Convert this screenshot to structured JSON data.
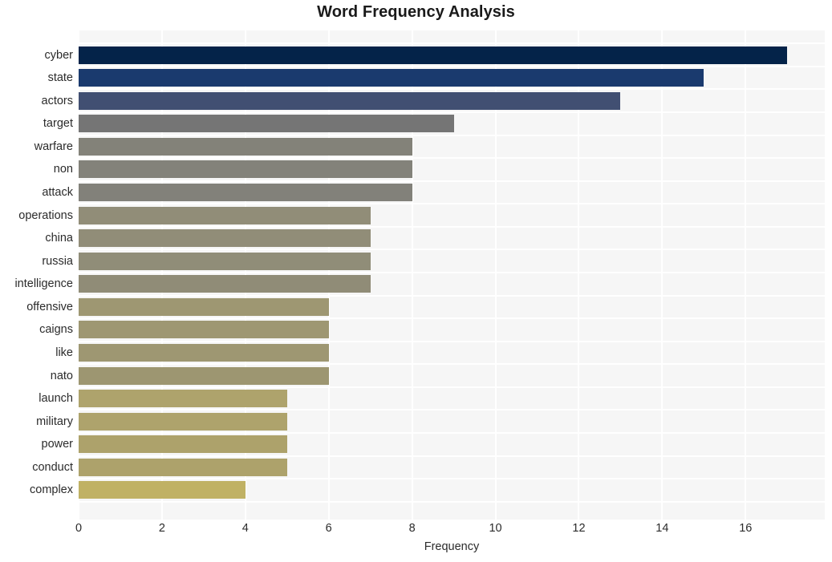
{
  "chart_data": {
    "type": "bar",
    "orientation": "horizontal",
    "title": "Word Frequency Analysis",
    "xlabel": "Frequency",
    "ylabel": "",
    "categories": [
      "cyber",
      "state",
      "actors",
      "target",
      "warfare",
      "non",
      "attack",
      "operations",
      "china",
      "russia",
      "intelligence",
      "offensive",
      "caigns",
      "like",
      "nato",
      "launch",
      "military",
      "power",
      "conduct",
      "complex"
    ],
    "values": [
      17,
      15,
      13,
      9,
      8,
      8,
      8,
      7,
      7,
      7,
      7,
      6,
      6,
      6,
      6,
      5,
      5,
      5,
      5,
      4
    ],
    "bar_colors": [
      "#042349",
      "#1a3a6e",
      "#414f72",
      "#757575",
      "#838279",
      "#83827a",
      "#82817a",
      "#918d78",
      "#918d78",
      "#908d78",
      "#908c77",
      "#9e9772",
      "#9e9772",
      "#9e9772",
      "#9d9671",
      "#aea36c",
      "#aea36c",
      "#ada26b",
      "#ada26b",
      "#c0b164"
    ],
    "xlim": [
      0,
      17.9
    ],
    "xticks": [
      0,
      2,
      4,
      6,
      8,
      10,
      12,
      14,
      16
    ],
    "xtick_labels": [
      "0",
      "2",
      "4",
      "6",
      "8",
      "10",
      "12",
      "14",
      "16"
    ],
    "grid": true,
    "grid_color": "#ffffff",
    "plot_background": "#f6f6f6",
    "figure_background": "#ffffff",
    "legend": null
  }
}
